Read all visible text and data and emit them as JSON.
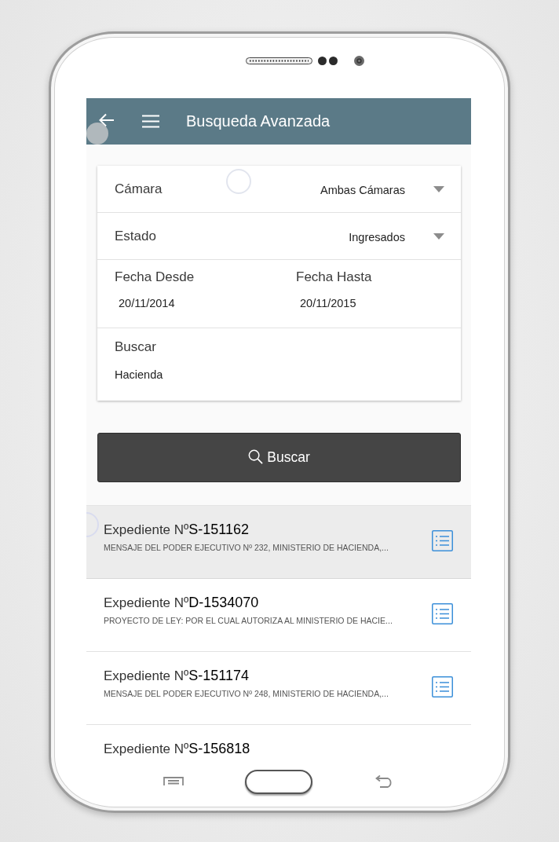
{
  "app_bar": {
    "title": "Busqueda Avanzada"
  },
  "form": {
    "selects": [
      {
        "label": "Cámara",
        "value": "Ambas Cámaras"
      },
      {
        "label": "Estado",
        "value": "Ingresados"
      }
    ],
    "dates": [
      {
        "label": "Fecha Desde",
        "value": "20/11/2014"
      },
      {
        "label": "Fecha Hasta",
        "value": "20/11/2015"
      }
    ],
    "search": {
      "label": "Buscar",
      "value": "Hacienda"
    }
  },
  "search_button": {
    "label": "Buscar"
  },
  "results": [
    {
      "title": "Expediente Nº**S-151162**",
      "summary": "MENSAJE DEL PODER EJECUTIVO Nº 232, MINISTERIO DE HACIENDA,...",
      "selected": true
    },
    {
      "title": "Expediente Nº**D-1534070**",
      "summary": "PROYECTO DE LEY: POR EL CUAL AUTORIZA AL MINISTERIO DE HACIE...",
      "selected": false
    },
    {
      "title": "Expediente Nº**S-151174**",
      "summary": "MENSAJE DEL PODER EJECUTIVO Nº 248, MINISTERIO DE HACIENDA,...",
      "selected": false
    },
    {
      "title": "Expediente Nº**S-156818**",
      "selected": false
    }
  ]
}
